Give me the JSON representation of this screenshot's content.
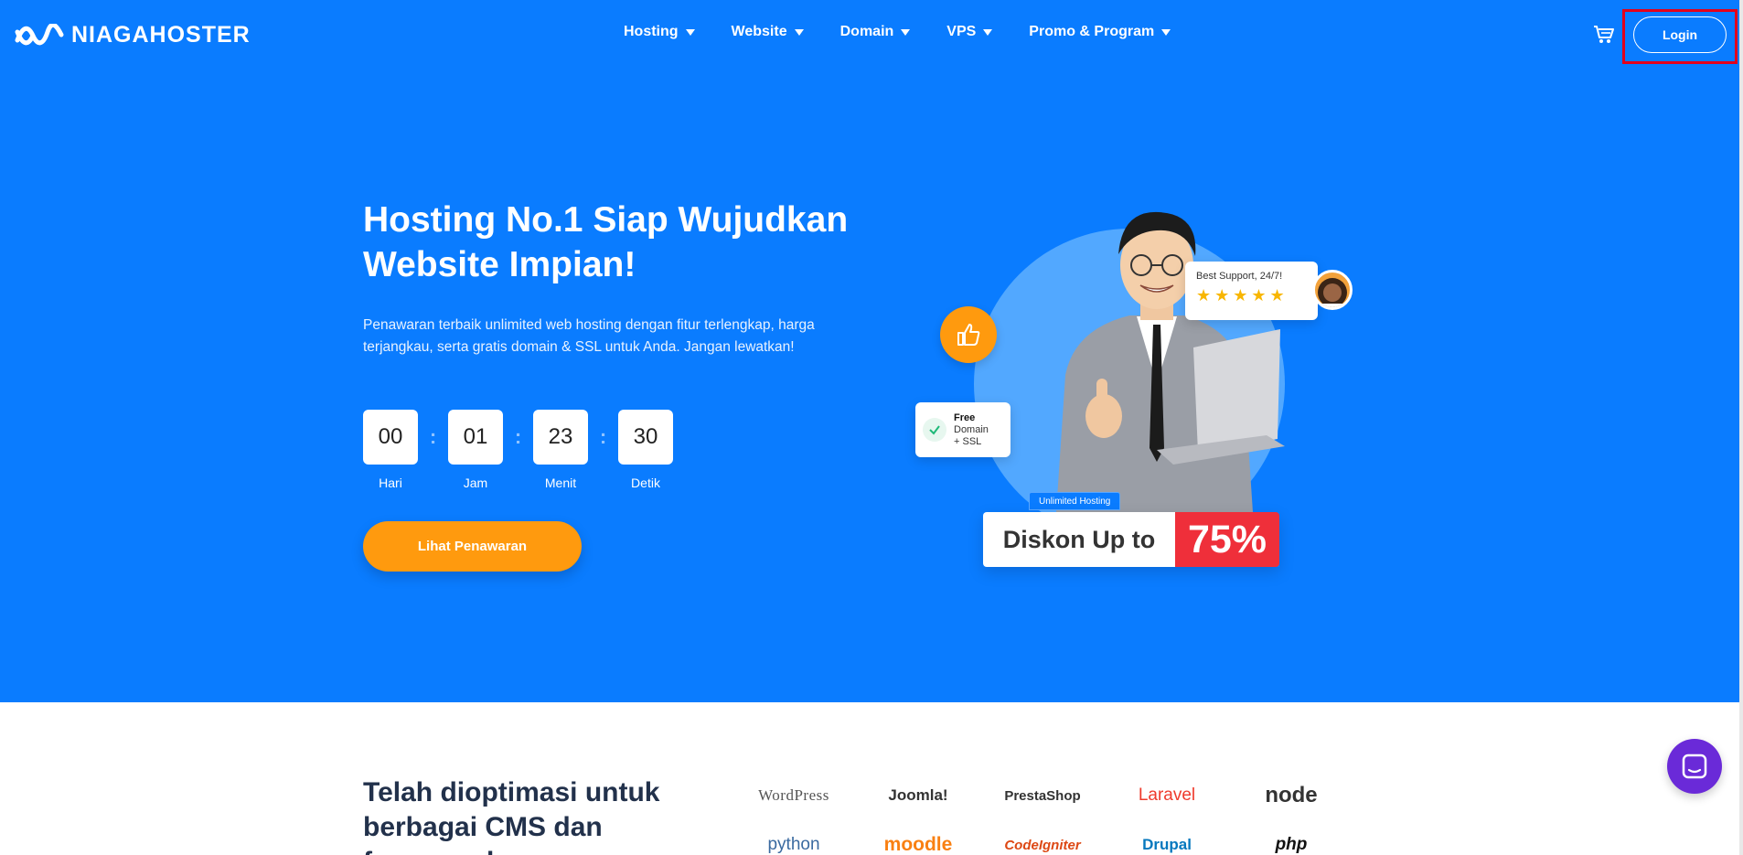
{
  "header": {
    "logo_text": "NIAGAHOSTER",
    "nav": [
      {
        "label": "Hosting"
      },
      {
        "label": "Website"
      },
      {
        "label": "Domain"
      },
      {
        "label": "VPS"
      },
      {
        "label": "Promo & Program"
      }
    ],
    "login_label": "Login"
  },
  "hero": {
    "title": "Hosting No.1 Siap Wujudkan Website Impian!",
    "description": "Penawaran terbaik unlimited web hosting dengan fitur terlengkap, harga terjangkau, serta gratis domain & SSL untuk Anda. Jangan lewatkan!",
    "countdown": [
      {
        "value": "00",
        "label": "Hari"
      },
      {
        "value": "01",
        "label": "Jam"
      },
      {
        "value": "23",
        "label": "Menit"
      },
      {
        "value": "30",
        "label": "Detik"
      }
    ],
    "cta_label": "Lihat Penawaran"
  },
  "illustration": {
    "support_text": "Best Support, 24/7!",
    "stars": "★★★★★",
    "ssl_line1": "Free",
    "ssl_line2": "Domain",
    "ssl_line3": "+ SSL",
    "tag": "Unlimited Hosting",
    "diskon_text": "Diskon Up to",
    "diskon_value": "75%"
  },
  "cms": {
    "title": "Telah dioptimasi untuk berbagai CMS dan framework",
    "logos": [
      "WordPress",
      "Joomla!",
      "PrestaShop",
      "Laravel",
      "node",
      "python",
      "moodle",
      "CodeIgniter",
      "Drupal",
      "php"
    ]
  },
  "colors": {
    "brand_blue": "#0a7cff",
    "cta_orange": "#ff9a0e",
    "discount_red": "#ef2f3a",
    "chat_purple": "#6a2ad8"
  }
}
